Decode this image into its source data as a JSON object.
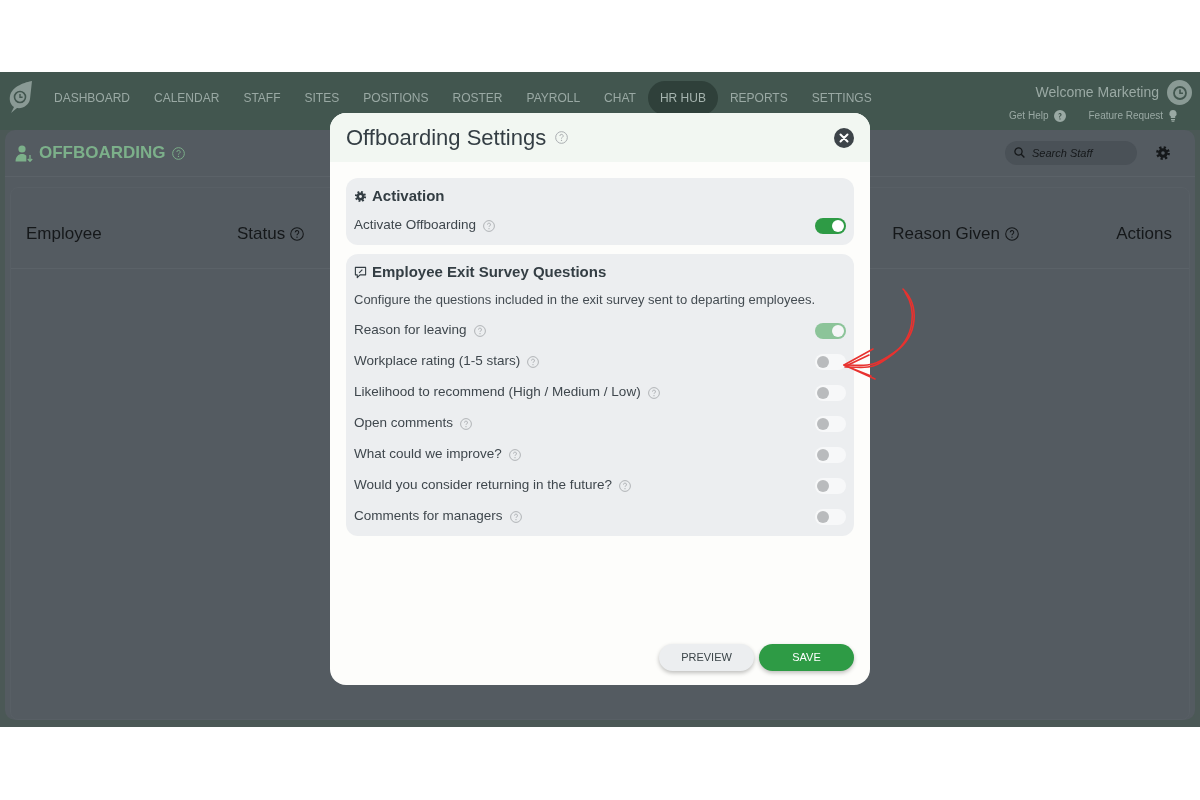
{
  "nav": {
    "items": [
      {
        "label": "DASHBOARD",
        "selected": false
      },
      {
        "label": "CALENDAR",
        "selected": false
      },
      {
        "label": "STAFF",
        "selected": false
      },
      {
        "label": "SITES",
        "selected": false
      },
      {
        "label": "POSITIONS",
        "selected": false
      },
      {
        "label": "ROSTER",
        "selected": false
      },
      {
        "label": "PAYROLL",
        "selected": false
      },
      {
        "label": "CHAT",
        "selected": false
      },
      {
        "label": "HR HUB",
        "selected": true
      },
      {
        "label": "REPORTS",
        "selected": false
      },
      {
        "label": "SETTINGS",
        "selected": false
      }
    ],
    "welcome": "Welcome Marketing",
    "links": [
      {
        "kind": "help",
        "label": "Get Help"
      },
      {
        "kind": "idea",
        "label": "Feature Request"
      }
    ]
  },
  "page": {
    "title": "OFFBOARDING",
    "search": {
      "placeholder": "Search Staff"
    },
    "table": {
      "columns": [
        {
          "label": "Employee",
          "help": false
        },
        {
          "label": "Status",
          "help": true
        },
        {
          "label": "Reason Given",
          "help": true
        },
        {
          "label": "Actions",
          "help": false
        }
      ]
    }
  },
  "modal": {
    "title": "Offboarding Settings",
    "sections": [
      {
        "kind": "activation",
        "title": "Activation",
        "items": [
          {
            "label": "Activate Offboarding",
            "on": true,
            "disabled": false
          }
        ]
      },
      {
        "kind": "survey",
        "title": "Employee Exit Survey Questions",
        "description": "Configure the questions included in the exit survey sent to departing employees.",
        "items": [
          {
            "label": "Reason for leaving",
            "on": true,
            "disabled": true
          },
          {
            "label": "Workplace rating (1-5 stars)",
            "on": false,
            "disabled": false
          },
          {
            "label": "Likelihood to recommend (High / Medium / Low)",
            "on": false,
            "disabled": false
          },
          {
            "label": "Open comments",
            "on": false,
            "disabled": false
          },
          {
            "label": "What could we improve?",
            "on": false,
            "disabled": false
          },
          {
            "label": "Would you consider returning in the future?",
            "on": false,
            "disabled": false
          },
          {
            "label": "Comments for managers",
            "on": false,
            "disabled": false
          }
        ]
      }
    ],
    "buttons": [
      {
        "kind": "secondary",
        "label": "PREVIEW"
      },
      {
        "kind": "primary",
        "label": "SAVE"
      }
    ]
  }
}
